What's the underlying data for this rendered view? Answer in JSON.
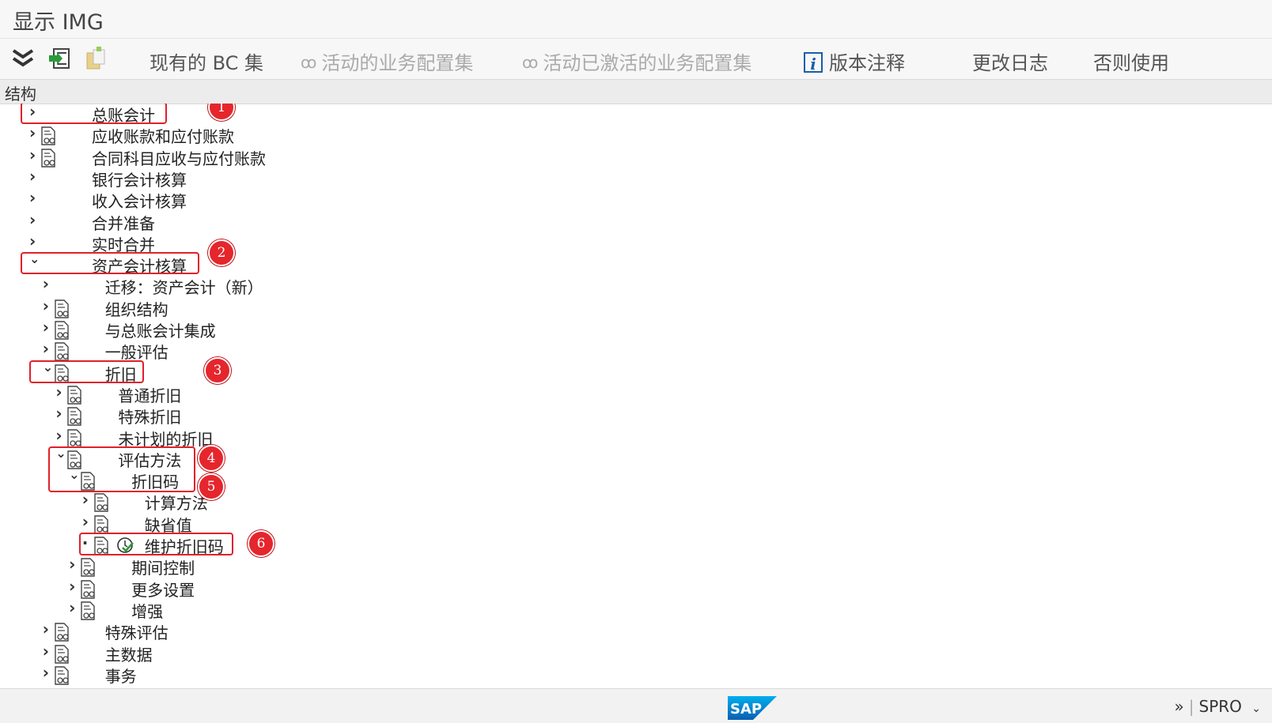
{
  "window": {
    "title": "显示 IMG"
  },
  "toolbar": {
    "existing_bc_sets": "现有的 BC 集",
    "active_bc_sets": "活动的业务配置集",
    "activated_bc_sets": "活动已激活的业务配置集",
    "release_notes": "版本注释",
    "change_log": "更改日志",
    "where_used": "否则使用"
  },
  "structure_header": "结构",
  "tree": {
    "items": [
      {
        "label": "总账会计",
        "level": 0,
        "expanded": false,
        "doc": false
      },
      {
        "label": "应收账款和应付账款",
        "level": 0,
        "expanded": false,
        "doc": true
      },
      {
        "label": "合同科目应收与应付账款",
        "level": 0,
        "expanded": false,
        "doc": true
      },
      {
        "label": "银行会计核算",
        "level": 0,
        "expanded": false,
        "doc": false
      },
      {
        "label": "收入会计核算",
        "level": 0,
        "expanded": false,
        "doc": false
      },
      {
        "label": "合并准备",
        "level": 0,
        "expanded": false,
        "doc": false
      },
      {
        "label": "实时合并",
        "level": 0,
        "expanded": false,
        "doc": false
      },
      {
        "label": "资产会计核算",
        "level": 0,
        "expanded": true,
        "doc": false
      },
      {
        "label": "迁移：资产会计（新）",
        "level": 1,
        "expanded": false,
        "doc": false
      },
      {
        "label": "组织结构",
        "level": 1,
        "expanded": false,
        "doc": true
      },
      {
        "label": "与总账会计集成",
        "level": 1,
        "expanded": false,
        "doc": true
      },
      {
        "label": "一般评估",
        "level": 1,
        "expanded": false,
        "doc": true
      },
      {
        "label": "折旧",
        "level": 1,
        "expanded": true,
        "doc": true
      },
      {
        "label": "普通折旧",
        "level": 2,
        "expanded": false,
        "doc": true
      },
      {
        "label": "特殊折旧",
        "level": 2,
        "expanded": false,
        "doc": true
      },
      {
        "label": "未计划的折旧",
        "level": 2,
        "expanded": false,
        "doc": true
      },
      {
        "label": "评估方法",
        "level": 2,
        "expanded": true,
        "doc": true
      },
      {
        "label": "折旧码",
        "level": 3,
        "expanded": true,
        "doc": true
      },
      {
        "label": "计算方法",
        "level": 4,
        "expanded": false,
        "doc": true
      },
      {
        "label": "缺省值",
        "level": 4,
        "expanded": false,
        "doc": true
      },
      {
        "label": "维护折旧码",
        "level": 4,
        "expanded": null,
        "doc": true,
        "executable": true
      },
      {
        "label": "期间控制",
        "level": 3,
        "expanded": false,
        "doc": true
      },
      {
        "label": "更多设置",
        "level": 3,
        "expanded": false,
        "doc": true
      },
      {
        "label": "增强",
        "level": 3,
        "expanded": false,
        "doc": true
      },
      {
        "label": "特殊评估",
        "level": 1,
        "expanded": false,
        "doc": true
      },
      {
        "label": "主数据",
        "level": 1,
        "expanded": false,
        "doc": true
      },
      {
        "label": "事务",
        "level": 1,
        "expanded": false,
        "doc": true
      }
    ]
  },
  "annotations": [
    "1",
    "2",
    "3",
    "4",
    "5",
    "6"
  ],
  "status": {
    "overflow": "»",
    "transaction": "SPRO",
    "sap_logo": "SAP"
  },
  "colors": {
    "highlight": "#e0202a",
    "badge": "#e5262c",
    "sap_blue": "#1a8bd8"
  }
}
